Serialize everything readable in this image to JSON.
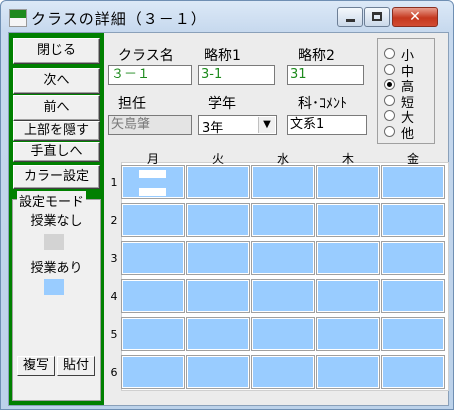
{
  "window": {
    "title": "クラスの詳細（３－１）",
    "close_glyph": "✕"
  },
  "sidebar": {
    "close_label": "閉じる",
    "next_label": "次へ",
    "prev_label": "前へ",
    "hide_top_label": "上部を隠す",
    "manual_label": "手直しへ",
    "color_label": "カラー設定",
    "setting_mode": {
      "title": "設定モード",
      "no_class_label": "授業なし",
      "no_class_color": "#d3d3d3",
      "has_class_label": "授業あり",
      "has_class_color": "#99ccff"
    },
    "copy_label": "複写",
    "paste_label": "貼付"
  },
  "form": {
    "class_name_label": "クラス名",
    "class_name_value": "３－１",
    "abbr1_label": "略称1",
    "abbr1_value": "3-1",
    "abbr2_label": "略称2",
    "abbr2_value": "31",
    "teacher_label": "担任",
    "teacher_value": "矢島肇",
    "grade_label": "学年",
    "grade_value": "3年",
    "comment_label": "科･ｺﾒﾝﾄ",
    "comment_value": "文系1"
  },
  "school_type": {
    "options": [
      "小",
      "中",
      "高",
      "短",
      "大",
      "他"
    ],
    "selected_index": 2
  },
  "timetable": {
    "days": [
      "月",
      "火",
      "水",
      "木",
      "金"
    ],
    "periods": [
      "1",
      "2",
      "3",
      "4",
      "5",
      "6"
    ],
    "cell_color": "#99ccff"
  }
}
